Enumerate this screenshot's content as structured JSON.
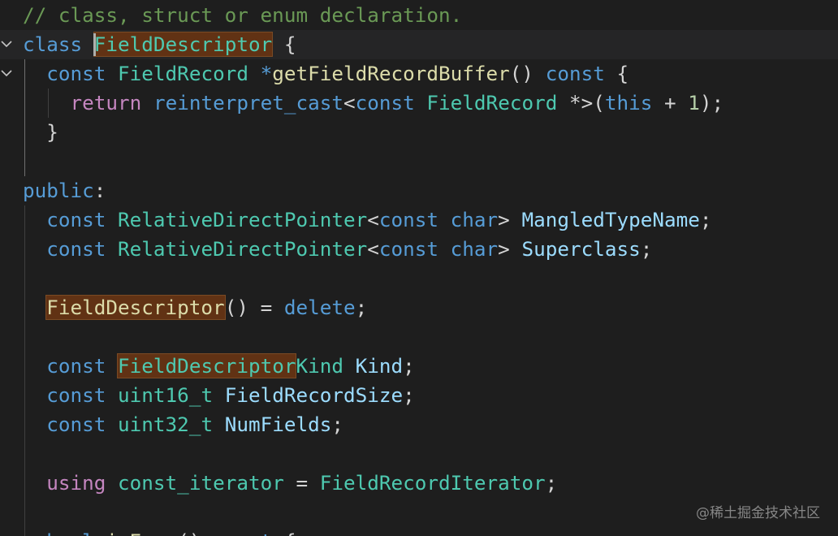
{
  "editor": {
    "lines": [
      [
        {
          "t": "// class, struct or enum declaration.",
          "c": "comment"
        }
      ],
      [
        {
          "t": "class",
          "c": "kw"
        },
        {
          "t": " ",
          "c": "plain"
        },
        {
          "t": "FieldDescriptor",
          "c": "type",
          "hl": true
        },
        {
          "t": " {",
          "c": "plain"
        }
      ],
      [
        {
          "t": "  ",
          "c": "plain"
        },
        {
          "t": "const",
          "c": "kw"
        },
        {
          "t": " ",
          "c": "plain"
        },
        {
          "t": "FieldRecord",
          "c": "type"
        },
        {
          "t": " *",
          "c": "kw"
        },
        {
          "t": "getFieldRecordBuffer",
          "c": "fn"
        },
        {
          "t": "() ",
          "c": "plain"
        },
        {
          "t": "const",
          "c": "kw"
        },
        {
          "t": " {",
          "c": "plain"
        }
      ],
      [
        {
          "t": "    ",
          "c": "plain"
        },
        {
          "t": "return",
          "c": "ctrl"
        },
        {
          "t": " ",
          "c": "plain"
        },
        {
          "t": "reinterpret_cast",
          "c": "kw"
        },
        {
          "t": "<",
          "c": "plain"
        },
        {
          "t": "const",
          "c": "kw"
        },
        {
          "t": " ",
          "c": "plain"
        },
        {
          "t": "FieldRecord",
          "c": "type"
        },
        {
          "t": " *",
          "c": "plain"
        },
        {
          "t": ">(",
          "c": "plain"
        },
        {
          "t": "this",
          "c": "kw"
        },
        {
          "t": " + ",
          "c": "plain"
        },
        {
          "t": "1",
          "c": "num"
        },
        {
          "t": ");",
          "c": "plain"
        }
      ],
      [
        {
          "t": "  }",
          "c": "plain"
        }
      ],
      [],
      [
        {
          "t": "public",
          "c": "kw"
        },
        {
          "t": ":",
          "c": "plain"
        }
      ],
      [
        {
          "t": "  ",
          "c": "plain"
        },
        {
          "t": "const",
          "c": "kw"
        },
        {
          "t": " ",
          "c": "plain"
        },
        {
          "t": "RelativeDirectPointer",
          "c": "type"
        },
        {
          "t": "<",
          "c": "plain"
        },
        {
          "t": "const",
          "c": "kw"
        },
        {
          "t": " ",
          "c": "plain"
        },
        {
          "t": "char",
          "c": "kw"
        },
        {
          "t": "> ",
          "c": "plain"
        },
        {
          "t": "MangledTypeName",
          "c": "var"
        },
        {
          "t": ";",
          "c": "plain"
        }
      ],
      [
        {
          "t": "  ",
          "c": "plain"
        },
        {
          "t": "const",
          "c": "kw"
        },
        {
          "t": " ",
          "c": "plain"
        },
        {
          "t": "RelativeDirectPointer",
          "c": "type"
        },
        {
          "t": "<",
          "c": "plain"
        },
        {
          "t": "const",
          "c": "kw"
        },
        {
          "t": " ",
          "c": "plain"
        },
        {
          "t": "char",
          "c": "kw"
        },
        {
          "t": "> ",
          "c": "plain"
        },
        {
          "t": "Superclass",
          "c": "var"
        },
        {
          "t": ";",
          "c": "plain"
        }
      ],
      [],
      [
        {
          "t": "  ",
          "c": "plain"
        },
        {
          "t": "FieldDescriptor",
          "c": "fn",
          "hl": true
        },
        {
          "t": "() = ",
          "c": "plain"
        },
        {
          "t": "delete",
          "c": "kw"
        },
        {
          "t": ";",
          "c": "plain"
        }
      ],
      [],
      [
        {
          "t": "  ",
          "c": "plain"
        },
        {
          "t": "const",
          "c": "kw"
        },
        {
          "t": " ",
          "c": "plain"
        },
        {
          "t": "FieldDescriptor",
          "c": "type",
          "hl": true
        },
        {
          "t": "Kind",
          "c": "type"
        },
        {
          "t": " ",
          "c": "plain"
        },
        {
          "t": "Kind",
          "c": "var"
        },
        {
          "t": ";",
          "c": "plain"
        }
      ],
      [
        {
          "t": "  ",
          "c": "plain"
        },
        {
          "t": "const",
          "c": "kw"
        },
        {
          "t": " ",
          "c": "plain"
        },
        {
          "t": "uint16_t",
          "c": "type"
        },
        {
          "t": " ",
          "c": "plain"
        },
        {
          "t": "FieldRecordSize",
          "c": "var"
        },
        {
          "t": ";",
          "c": "plain"
        }
      ],
      [
        {
          "t": "  ",
          "c": "plain"
        },
        {
          "t": "const",
          "c": "kw"
        },
        {
          "t": " ",
          "c": "plain"
        },
        {
          "t": "uint32_t",
          "c": "type"
        },
        {
          "t": " ",
          "c": "plain"
        },
        {
          "t": "NumFields",
          "c": "var"
        },
        {
          "t": ";",
          "c": "plain"
        }
      ],
      [],
      [
        {
          "t": "  ",
          "c": "plain"
        },
        {
          "t": "using",
          "c": "ctrl"
        },
        {
          "t": " ",
          "c": "plain"
        },
        {
          "t": "const_iterator",
          "c": "type"
        },
        {
          "t": " = ",
          "c": "plain"
        },
        {
          "t": "FieldRecordIterator",
          "c": "type"
        },
        {
          "t": ";",
          "c": "plain"
        }
      ],
      [],
      [
        {
          "t": "  ",
          "c": "plain"
        },
        {
          "t": "bool",
          "c": "kw"
        },
        {
          "t": " ",
          "c": "plain"
        },
        {
          "t": "isEnum",
          "c": "fn"
        },
        {
          "t": "() ",
          "c": "plain"
        },
        {
          "t": "const",
          "c": "kw"
        },
        {
          "t": " {",
          "c": "plain"
        }
      ]
    ],
    "fold_lines": [
      1,
      2
    ],
    "current_line": 1,
    "cursor_line": 1
  },
  "watermark": "@稀土掘金技术社区",
  "colors": {
    "background": "#1e1e1e",
    "comment": "#6a9955",
    "kw": "#569cd6",
    "ctrl": "#c586c0",
    "type": "#4ec9b0",
    "fn": "#dcdcaa",
    "var": "#9cdcfe",
    "num": "#b5cea8",
    "plain": "#d4d4d4",
    "highlight": "#613214"
  }
}
